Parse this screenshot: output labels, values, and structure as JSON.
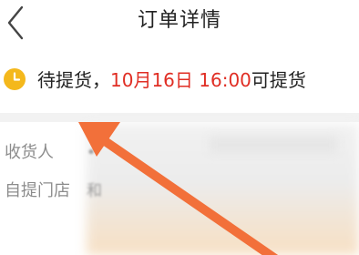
{
  "header": {
    "title": "订单详情",
    "back_icon": "chevron-left-icon"
  },
  "status": {
    "icon": "clock-icon",
    "prefix": "待提货，",
    "highlight": "10月16日 16:00",
    "suffix": "可提货",
    "highlight_color": "#e02e24",
    "icon_color": "#f4b81c"
  },
  "details": {
    "receiver_label": "收货人",
    "receiver_value": "•",
    "store_label": "自提门店",
    "store_value": "和"
  },
  "annotation": {
    "arrow_color": "#f2703a"
  }
}
